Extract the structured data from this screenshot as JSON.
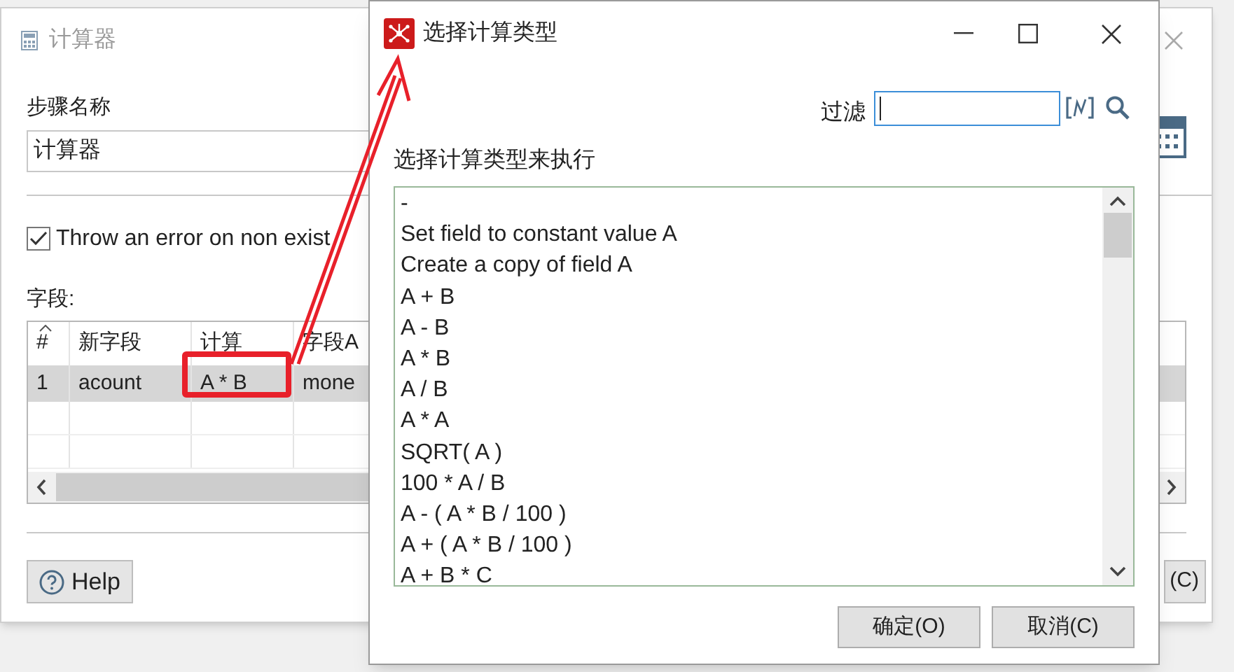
{
  "main_window": {
    "title": "计算器",
    "step_name_label": "步骤名称",
    "step_name_value": "计算器",
    "error_checkbox": {
      "label": "Throw an error on non exist",
      "checked": true
    },
    "fields_label": "字段:",
    "table": {
      "columns": [
        "#",
        "新字段",
        "计算",
        "字段A"
      ],
      "rows": [
        {
          "cells": [
            "1",
            "acount",
            "A * B",
            "mone"
          ],
          "selected": true
        }
      ]
    },
    "help_button": "Help",
    "cancel_button": "(C)"
  },
  "dialog": {
    "title": "选择计算类型",
    "filter_label": "过滤",
    "list_label": "选择计算类型来执行",
    "items": [
      "-",
      "Set field to constant value A",
      "Create a copy of field A",
      "A + B",
      "A - B",
      "A * B",
      "A / B",
      "A * A",
      "SQRT( A )",
      "100 * A / B",
      "A - ( A * B / 100 )",
      "A + ( A * B / 100 )",
      "A + B * C"
    ],
    "buttons": [
      "确定(O)",
      "取消(C)"
    ]
  }
}
